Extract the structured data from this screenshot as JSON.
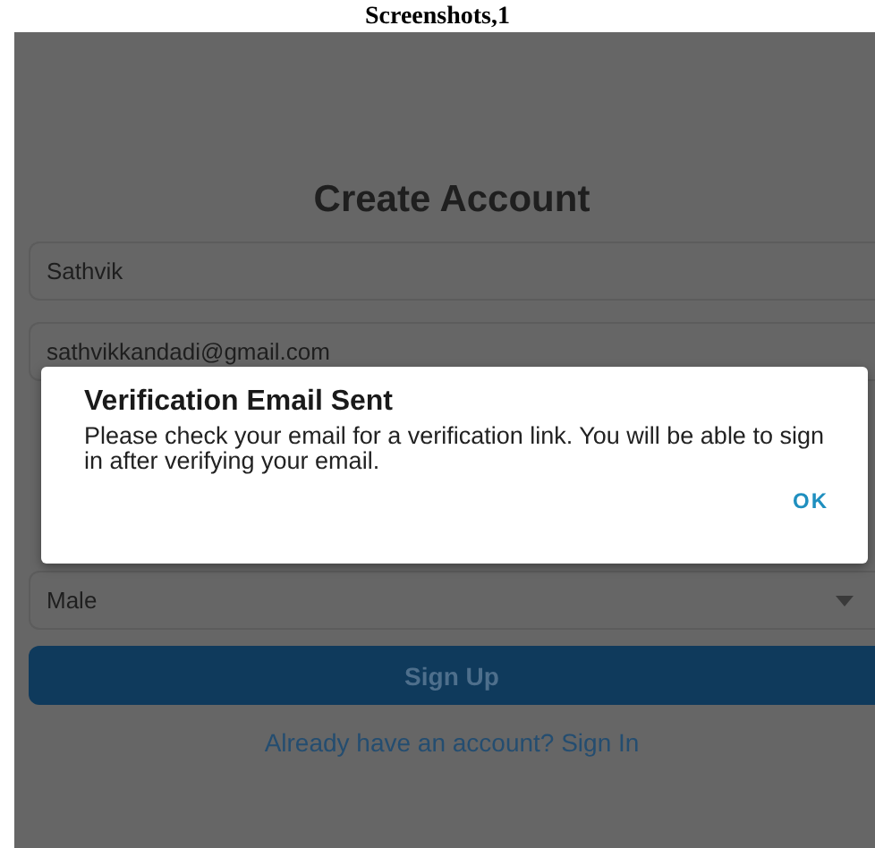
{
  "caption": "Screenshots,1",
  "title": "Create Account",
  "fields": [
    {
      "kind": "text",
      "value": "Sathvik"
    },
    {
      "kind": "text",
      "value": "sathvikkandadi@gmail.com"
    },
    {
      "kind": "select",
      "value": "Male"
    }
  ],
  "primary_button": "Sign Up",
  "sign_in_link": "Already have an account? Sign In",
  "dialog": {
    "title": "Verification Email Sent",
    "message": "Please check your email for a verification link. You will be able to sign in after verifying your email.",
    "button": "OK"
  }
}
